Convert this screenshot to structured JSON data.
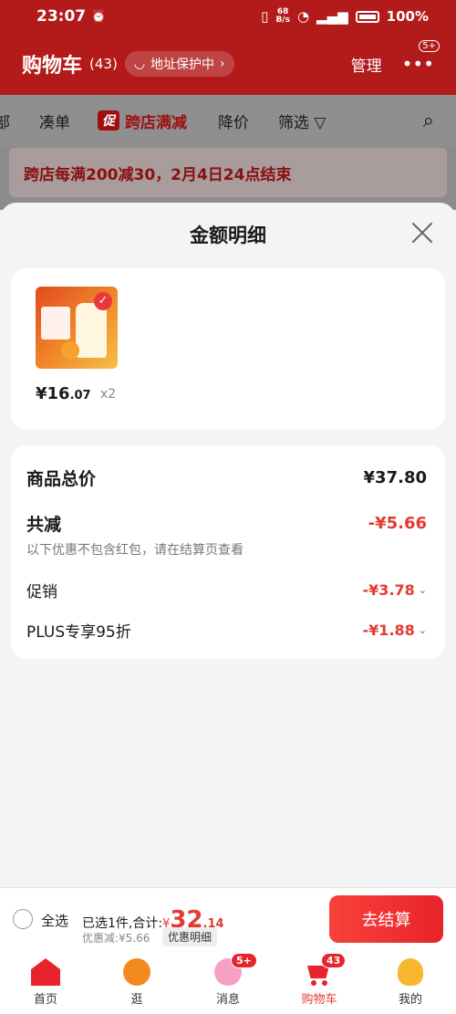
{
  "status_bar": {
    "time": "23:07",
    "net_speed_top": "68",
    "net_speed_bottom": "B/s",
    "battery": "100%"
  },
  "header": {
    "title": "购物车",
    "count": "(43)",
    "address_protection": "地址保护中",
    "manage": "管理",
    "more_badge": "5+"
  },
  "filters": {
    "items": [
      "部",
      "凑单",
      "跨店满减",
      "降价",
      "筛选"
    ],
    "promo_tag": "促"
  },
  "banner": {
    "text": "跨店每满200减30，2月4日24点结束"
  },
  "sheet": {
    "title": "金额明细",
    "product": {
      "price_main": "¥16",
      "price_dec": ".07",
      "quantity": "x2"
    },
    "total_label": "商品总价",
    "total_value": "¥37.80",
    "reduce_label": "共减",
    "reduce_value": "-¥5.66",
    "note": "以下优惠不包含红包，请在结算页查看",
    "promo_label": "促销",
    "promo_value": "-¥3.78",
    "plus_label": "PLUS专享95折",
    "plus_value": "-¥1.88"
  },
  "checkout": {
    "select_all": "全选",
    "selected_text": "已选1件,合计:",
    "yen": "¥",
    "amount_int": "32",
    "amount_dec": ".14",
    "discount_text": "优惠减:¥5.66",
    "detail_button": "优惠明细",
    "checkout_button": "去结算"
  },
  "tabs": [
    {
      "label": "首页",
      "badge": ""
    },
    {
      "label": "逛",
      "badge": ""
    },
    {
      "label": "消息",
      "badge": "5+"
    },
    {
      "label": "购物车",
      "badge": "43"
    },
    {
      "label": "我的",
      "badge": ""
    }
  ],
  "colors": {
    "brand_red": "#e8232b",
    "price_red": "#e23b32",
    "dim_header": "#b31b1b"
  }
}
